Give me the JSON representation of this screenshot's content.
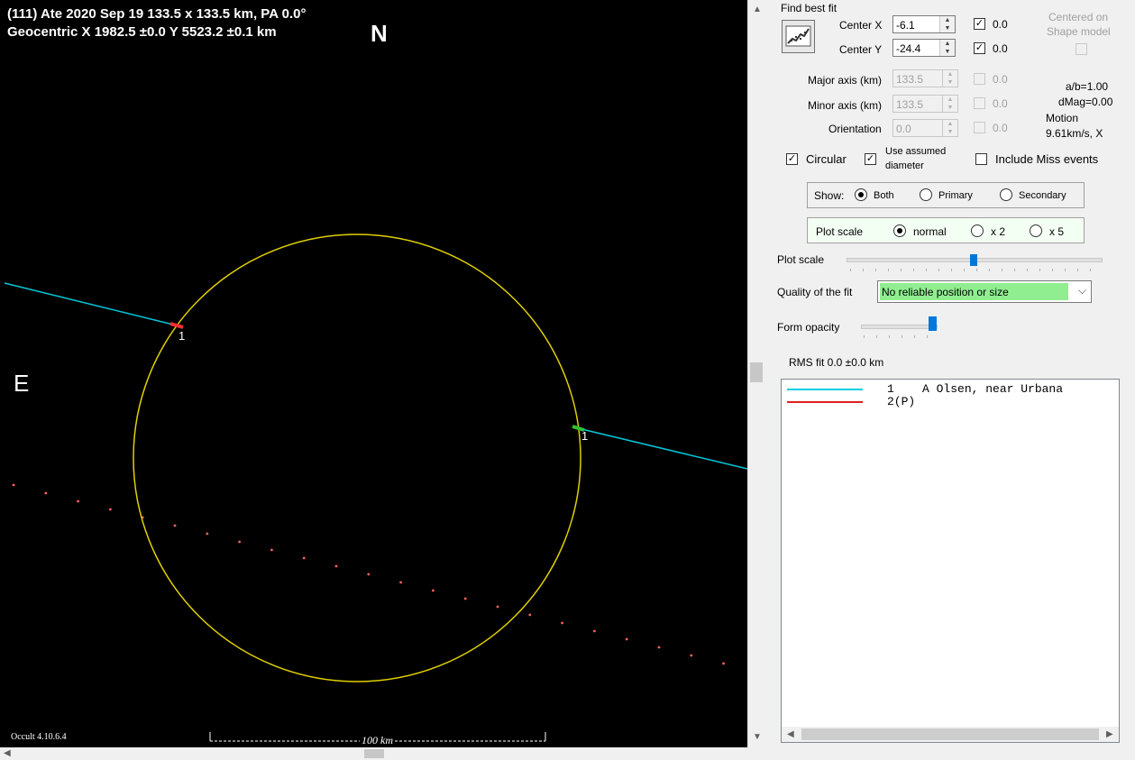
{
  "plot": {
    "title_line1": "(111) Ate  2020 Sep 19  133.5 x 133.5 km, PA 0.0°",
    "title_line2": "Geocentric  X  1982.5 ±0.0  Y 5523.2 ±0.1 km",
    "north": "N",
    "east": "E",
    "version": "Occult 4.10.6.4",
    "scale_bar": "100 km",
    "chord_label_left": "1",
    "chord_label_right": "1",
    "colors": {
      "background": "#000000",
      "ellipse": "#e0d000",
      "chord": "#00c8d8",
      "miss_dots": "#ff6060",
      "disappear": "#ff3030",
      "reappear": "#30c030"
    }
  },
  "panel": {
    "find_best_fit": "Find best fit",
    "find_best_fit_icon": "chart-fit-icon",
    "center_x_label": "Center X",
    "center_x_value": "-6.1",
    "center_x_fit": "0.0",
    "center_y_label": "Center Y",
    "center_y_value": "-24.4",
    "center_y_fit": "0.0",
    "centered_on": "Centered on",
    "shape_model": "Shape model",
    "major_label": "Major axis (km)",
    "major_value": "133.5",
    "major_fit": "0.0",
    "minor_label": "Minor axis (km)",
    "minor_value": "133.5",
    "minor_fit": "0.0",
    "orient_label": "Orientation",
    "orient_value": "0.0",
    "orient_fit": "0.0",
    "ab": "a/b=1.00",
    "dmag": "dMag=0.00",
    "motion_label": "Motion",
    "motion_value": "9.61km/s, X",
    "circular": "Circular",
    "use_assumed_1": "Use assumed",
    "use_assumed_2": "diameter",
    "include_miss": "Include Miss events",
    "show_label": "Show:",
    "show_both": "Both",
    "show_primary": "Primary",
    "show_secondary": "Secondary",
    "plotscale_group_label": "Plot scale",
    "scale_normal": "normal",
    "scale_x2": "x 2",
    "scale_x5": "x 5",
    "plotscale_slider_label": "Plot scale",
    "quality_label": "Quality of the fit",
    "quality_value": "No reliable position or size",
    "quality_color": "#90ee90",
    "form_opacity_label": "Form opacity",
    "rms_fit": "RMS fit 0.0 ±0.0 km",
    "list": [
      {
        "color": "#00d0e0",
        "text": "1    A Olsen, near Urbana"
      },
      {
        "color": "#e02020",
        "text": "2(P)"
      }
    ]
  }
}
